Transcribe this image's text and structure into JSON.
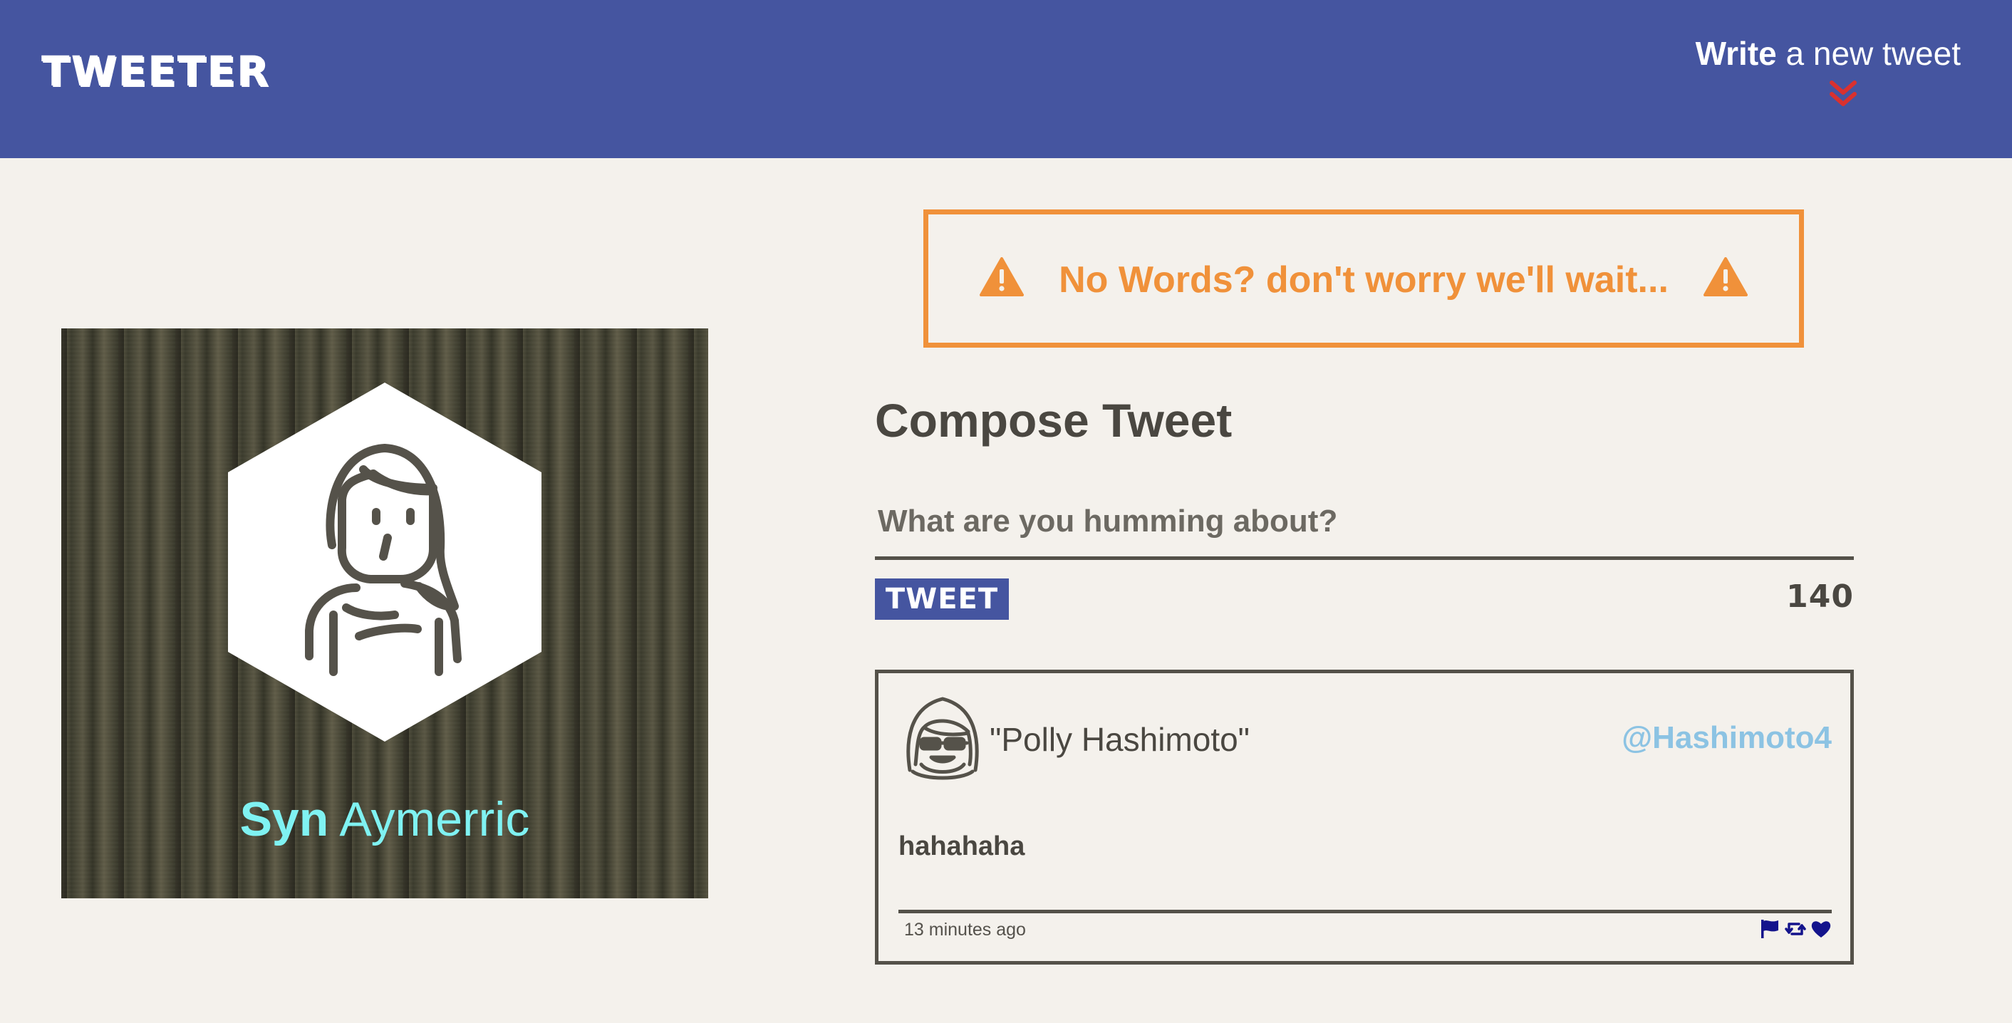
{
  "nav": {
    "brand": "TWEETER",
    "write_bold": "Write",
    "write_rest": " a new tweet",
    "chevron_icon": "double-chevron-down-icon",
    "chevron_color": "#d9312f"
  },
  "profile": {
    "first_name": "Syn",
    "last_name": " Aymerric",
    "avatar_icon": "female-avatar-icon",
    "name_color": "#7ff2f2"
  },
  "error": {
    "message": "No Words? don't worry we'll wait...",
    "icon": "warning-icon",
    "color": "#f0913a"
  },
  "composer": {
    "title": "Compose Tweet",
    "placeholder": "What are you humming about?",
    "value": "",
    "button_label": "TWEET",
    "counter": "140"
  },
  "tweets": [
    {
      "author": "\"Polly Hashimoto\"",
      "handle": "@Hashimoto4",
      "content": "hahahaha",
      "timestamp": "13 minutes ago",
      "avatar_icon": "sunglasses-avatar-icon",
      "actions": [
        "flag-icon",
        "retweet-icon",
        "heart-icon"
      ]
    }
  ],
  "colors": {
    "header": "#4555a0",
    "background": "#f4f1ec",
    "text": "#4a4741",
    "handle": "#8cc3e3",
    "action_icons": "#14148c"
  }
}
